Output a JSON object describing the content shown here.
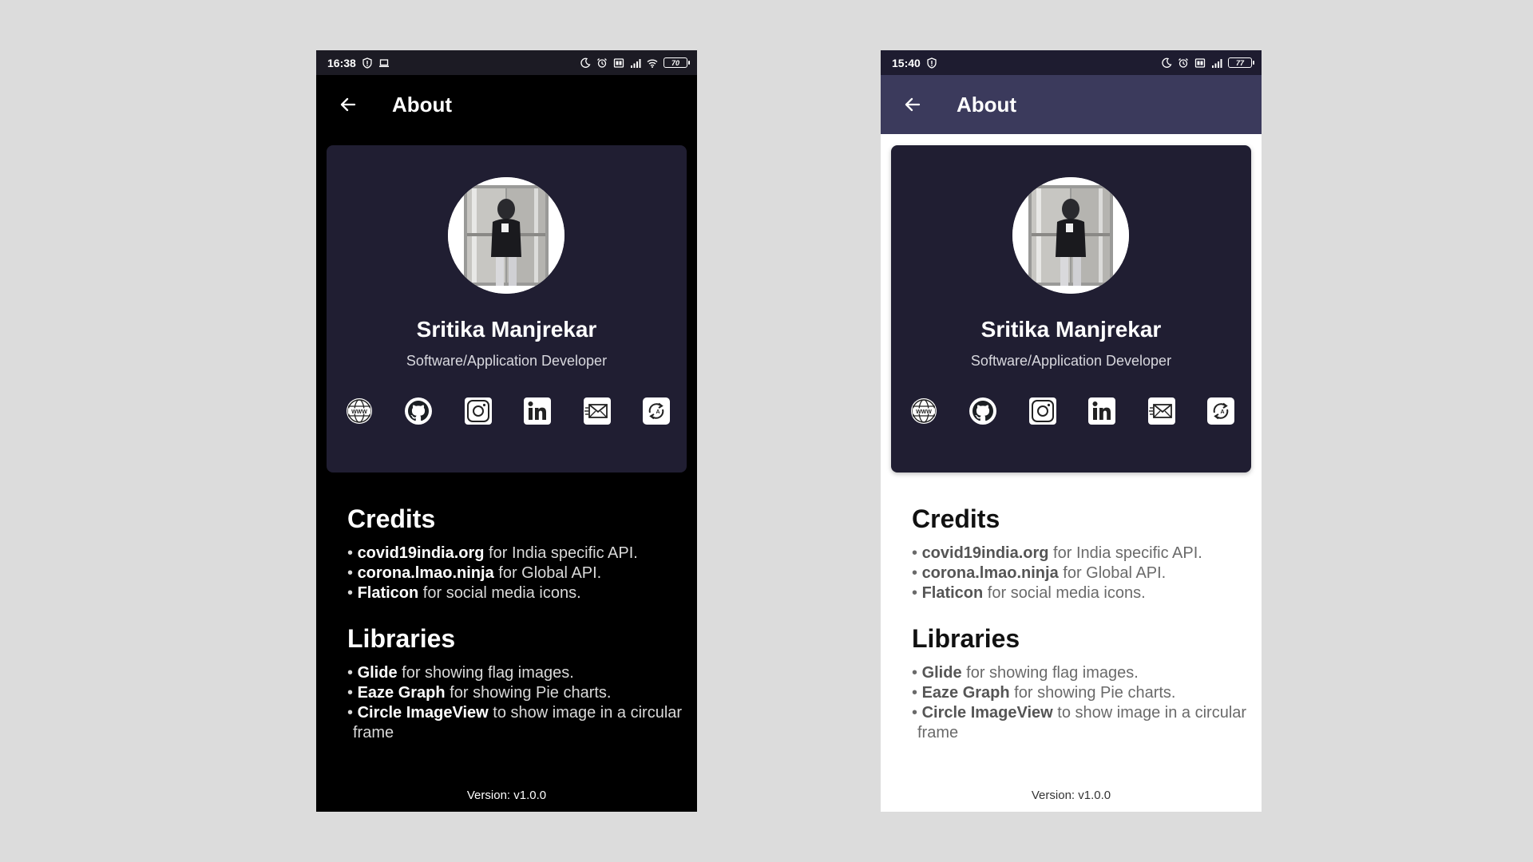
{
  "screens": [
    {
      "theme": "dark",
      "status": {
        "time": "16:38",
        "battery": "70"
      },
      "toolbar": {
        "title": "About"
      },
      "profile": {
        "name": "Sritika Manjrekar",
        "role": "Software/Application Developer"
      },
      "socials": [
        "globe-icon",
        "github-icon",
        "instagram-icon",
        "linkedin-icon",
        "email-icon",
        "share-icon"
      ],
      "credits": {
        "title": "Credits",
        "items": [
          {
            "bold": "covid19india.org",
            "text": " for India specific API."
          },
          {
            "bold": "corona.lmao.ninja",
            "text": " for Global API."
          },
          {
            "bold": "Flaticon",
            "text": " for social media icons."
          }
        ]
      },
      "libraries": {
        "title": "Libraries",
        "items": [
          {
            "bold": "Glide",
            "text": " for showing flag images."
          },
          {
            "bold": "Eaze Graph",
            "text": " for showing Pie charts."
          },
          {
            "bold": "Circle ImageView",
            "text": " to show image in a circular frame"
          }
        ]
      },
      "version": "Version: v1.0.0"
    },
    {
      "theme": "light",
      "status": {
        "time": "15:40",
        "battery": "77"
      },
      "toolbar": {
        "title": "About"
      },
      "profile": {
        "name": "Sritika Manjrekar",
        "role": "Software/Application Developer"
      },
      "socials": [
        "globe-icon",
        "github-icon",
        "instagram-icon",
        "linkedin-icon",
        "email-icon",
        "share-icon"
      ],
      "credits": {
        "title": "Credits",
        "items": [
          {
            "bold": "covid19india.org",
            "text": " for India specific API."
          },
          {
            "bold": "corona.lmao.ninja",
            "text": " for Global API."
          },
          {
            "bold": "Flaticon",
            "text": " for social media icons."
          }
        ]
      },
      "libraries": {
        "title": "Libraries",
        "items": [
          {
            "bold": "Glide",
            "text": " for showing flag images."
          },
          {
            "bold": "Eaze Graph",
            "text": " for showing Pie charts."
          },
          {
            "bold": "Circle ImageView",
            "text": " to show image in a circular frame"
          }
        ]
      },
      "version": "Version: v1.0.0"
    }
  ]
}
